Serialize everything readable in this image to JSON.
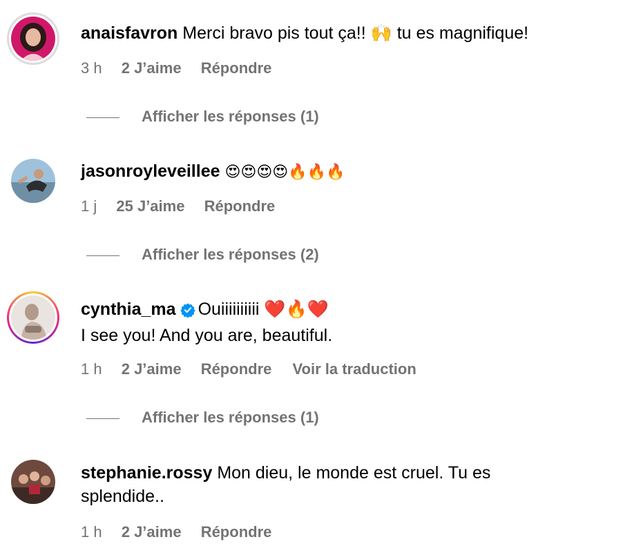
{
  "comments": [
    {
      "username": "anaisfavron",
      "text": "Merci bravo pis tout ça!! 🙌 tu es magnifique!",
      "time": "3 h",
      "likes": "2 J’aime",
      "reply": "Répondre",
      "view_replies": "Afficher les réponses (1)",
      "avatar_icon": "profile-photo"
    },
    {
      "username": "jasonroyleveillee",
      "text": "😍😍😍😍🔥🔥🔥",
      "time": "1 j",
      "likes": "25 J’aime",
      "reply": "Répondre",
      "view_replies": "Afficher les réponses (2)",
      "avatar_icon": "profile-photo"
    },
    {
      "username": "cynthia_ma",
      "verified": true,
      "text_line1": "Ouiiiiiiiiii ❤️🔥❤️",
      "text_line2": "I see you! And you are, beautiful.",
      "time": "1 h",
      "likes": "2 J’aime",
      "reply": "Répondre",
      "translate": "Voir la traduction",
      "view_replies": "Afficher les réponses (1)",
      "avatar_icon": "profile-photo"
    },
    {
      "username": "stephanie.rossy",
      "text_line1": "Mon dieu, le monde est cruel. Tu es",
      "text_line2": "splendide..",
      "time": "1 h",
      "likes": "2 J’aime",
      "reply": "Répondre",
      "avatar_icon": "profile-photo"
    }
  ],
  "colors": {
    "meta_text": "#737373",
    "verified_badge": "#0095f6",
    "story_ring_gradient": [
      "#f9ce34",
      "#ee2a7b",
      "#6228d7"
    ]
  }
}
